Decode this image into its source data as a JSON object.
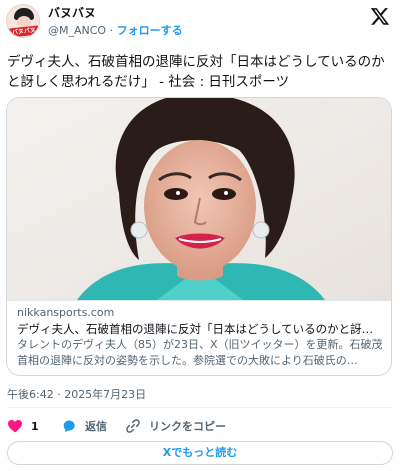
{
  "author": {
    "display_name": "バヌバヌ",
    "handle": "@M_ANCO",
    "separator": "·",
    "follow_label": "フォローする",
    "avatar_text": "バヌバヌ"
  },
  "tweet": {
    "text": "デヴィ夫人、石破首相の退陣に反対「日本はどうしているのかと訝しく思われるだけ」 - 社会 : 日刊スポーツ"
  },
  "card": {
    "domain": "nikkansports.com",
    "title": "デヴィ夫人、石破首相の退陣に反対「日本はどうしているのかと訝し…",
    "description": "タレントのデヴィ夫人（85）が23日、X（旧ツイッター）を更新。石破茂首相の退陣に反対の姿勢を示した。参院選での大敗により石破氏の…"
  },
  "timestamp": "午後6:42 · 2025年7月23日",
  "actions": {
    "like_count": "1",
    "reply_label": "返信",
    "copy_link_label": "リンクをコピー"
  },
  "read_more_label": "Xでもっと読む",
  "colors": {
    "accent": "#1d9bf0",
    "like": "#f91880",
    "text_secondary": "#536471",
    "border": "#cfd9de"
  },
  "icons": [
    "x-logo-icon",
    "heart-icon",
    "reply-icon",
    "link-icon"
  ]
}
